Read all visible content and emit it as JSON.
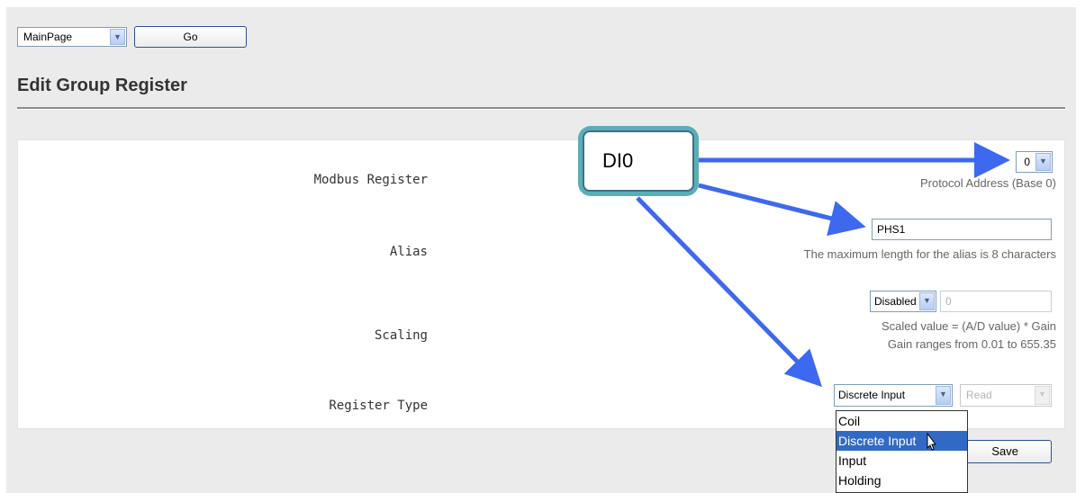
{
  "nav": {
    "page_select": "MainPage",
    "go_label": "Go"
  },
  "title": "Edit Group Register",
  "form": {
    "modbus_register": {
      "label": "Modbus Register",
      "value": "0",
      "hint": "Protocol Address (Base 0)"
    },
    "alias": {
      "label": "Alias",
      "value": "PHS1",
      "hint": "The maximum length for the alias is 8 characters"
    },
    "scaling": {
      "label": "Scaling",
      "mode": "Disabled",
      "gain": "0",
      "hint1": "Scaled value = (A/D value) * Gain",
      "hint2": "Gain ranges from 0.01 to 655.35"
    },
    "register_type": {
      "label": "Register Type",
      "value": "Discrete Input",
      "access": "Read",
      "options": [
        "Coil",
        "Discrete Input",
        "Input",
        "Holding"
      ]
    },
    "save_label": "Save"
  },
  "callout": {
    "text": "DI0"
  },
  "colors": {
    "arrow": "#3d68f0",
    "callout_border": "#5aaeb7",
    "highlight": "#316ac5"
  },
  "icons": {
    "dropdown": "chevron-down-icon",
    "cursor": "mouse-pointer-icon"
  }
}
